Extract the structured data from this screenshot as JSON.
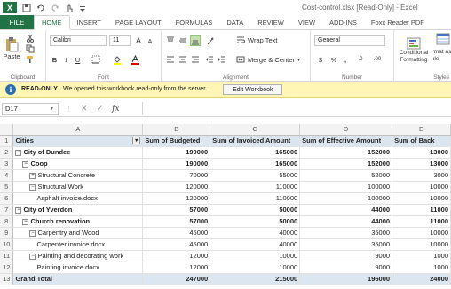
{
  "titlebar": {
    "app_icon": "X",
    "title": "Cost-control.xlsx  [Read-Only] - Excel"
  },
  "tabs": {
    "file": "FILE",
    "items": [
      "HOME",
      "INSERT",
      "PAGE LAYOUT",
      "FORMULAS",
      "DATA",
      "REVIEW",
      "VIEW",
      "ADD-INS",
      "Foxit Reader PDF"
    ],
    "active": "HOME"
  },
  "ribbon": {
    "clipboard_label": "Clipboard",
    "paste_label": "Paste",
    "font_label": "Font",
    "font_name": "Calibri",
    "font_size": "11",
    "bold": "B",
    "italic": "I",
    "underline": "U",
    "grow_font": "A",
    "shrink_font": "A",
    "alignment_label": "Alignment",
    "wrap_text": "Wrap Text",
    "merge_center": "Merge & Center",
    "number_label": "Number",
    "number_format": "General",
    "currency": "$",
    "percent": "%",
    "comma": ",",
    "decimals_inc": ".0",
    "decimals_dec": ".00",
    "styles_label": "Styles",
    "conditional_formatting": "Conditional Formatting",
    "format_as_table": "Format as Table"
  },
  "readonly_bar": {
    "tag": "READ-ONLY",
    "message": "We opened this workbook read-only from the server.",
    "button": "Edit Workbook"
  },
  "formula_bar": {
    "cell_ref": "D17",
    "fx": "fx",
    "value": ""
  },
  "grid": {
    "columns": [
      "A",
      "B",
      "C",
      "D",
      "E"
    ],
    "rows": [
      {
        "n": "1",
        "type": "hdr",
        "a": "Cities",
        "b": "Sum of Budgeted",
        "c": "Sum of Invoiced Amount",
        "d": "Sum of Effective Amount",
        "e": "Sum of Back",
        "toggle": "",
        "indent": 0
      },
      {
        "n": "2",
        "type": "bold",
        "a": "City of Dundee",
        "b": "190000",
        "c": "165000",
        "d": "152000",
        "e": "13000",
        "toggle": "−",
        "indent": 0
      },
      {
        "n": "3",
        "type": "bold",
        "a": "Coop",
        "b": "190000",
        "c": "165000",
        "d": "152000",
        "e": "13000",
        "toggle": "−",
        "indent": 1
      },
      {
        "n": "4",
        "type": "",
        "a": "Structural Concrete",
        "b": "70000",
        "c": "55000",
        "d": "52000",
        "e": "3000",
        "toggle": "+",
        "indent": 2
      },
      {
        "n": "5",
        "type": "",
        "a": "Structural Work",
        "b": "120000",
        "c": "110000",
        "d": "100000",
        "e": "10000",
        "toggle": "−",
        "indent": 2
      },
      {
        "n": "6",
        "type": "",
        "a": "Asphalt invoice.docx",
        "b": "120000",
        "c": "110000",
        "d": "100000",
        "e": "10000",
        "toggle": "",
        "indent": 3
      },
      {
        "n": "7",
        "type": "sub",
        "a": "City of Yverdon",
        "b": "57000",
        "c": "50000",
        "d": "44000",
        "e": "11000",
        "toggle": "−",
        "indent": 0
      },
      {
        "n": "8",
        "type": "bold",
        "a": "Church renovation",
        "b": "57000",
        "c": "50000",
        "d": "44000",
        "e": "11000",
        "toggle": "−",
        "indent": 1
      },
      {
        "n": "9",
        "type": "",
        "a": "Carpentry and Wood",
        "b": "45000",
        "c": "40000",
        "d": "35000",
        "e": "10000",
        "toggle": "−",
        "indent": 2
      },
      {
        "n": "10",
        "type": "",
        "a": "Carpenter invoice.docx",
        "b": "45000",
        "c": "40000",
        "d": "35000",
        "e": "10000",
        "toggle": "",
        "indent": 3
      },
      {
        "n": "11",
        "type": "",
        "a": "Painting and decorating work",
        "b": "12000",
        "c": "10000",
        "d": "9000",
        "e": "1000",
        "toggle": "−",
        "indent": 2
      },
      {
        "n": "12",
        "type": "",
        "a": "Painting invoice.docx",
        "b": "12000",
        "c": "10000",
        "d": "9000",
        "e": "1000",
        "toggle": "",
        "indent": 3
      },
      {
        "n": "13",
        "type": "grand",
        "a": "Grand Total",
        "b": "247000",
        "c": "215000",
        "d": "196000",
        "e": "24000",
        "toggle": "",
        "indent": 0
      }
    ]
  },
  "colors": {
    "excel_green": "#217346",
    "header_fill": "#dce6f1",
    "readonly_bar": "#fff5b5",
    "info_blue": "#2b6cb0"
  }
}
